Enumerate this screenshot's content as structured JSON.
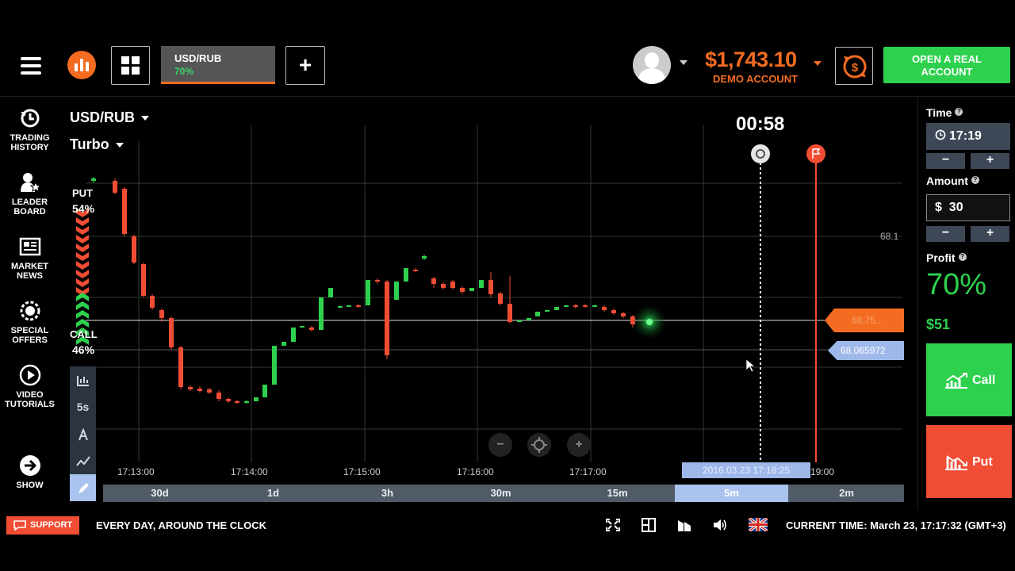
{
  "header": {
    "asset_tab": {
      "name": "USD/RUB",
      "payout": "70%"
    },
    "add_label": "+",
    "balance": "$1,743.10",
    "account_type": "DEMO ACCOUNT",
    "open_real_line1": "OPEN A REAL",
    "open_real_line2": "ACCOUNT",
    "accent_color": "#f36c21",
    "green_color": "#2ed14e"
  },
  "sidebar": {
    "items": [
      {
        "icon": "history-icon",
        "line1": "TRADING",
        "line2": "HISTORY"
      },
      {
        "icon": "leaderboard-icon",
        "line1": "LEADER",
        "line2": "BOARD"
      },
      {
        "icon": "newspaper-icon",
        "line1": "MARKET",
        "line2": "NEWS"
      },
      {
        "icon": "gear-icon",
        "line1": "SPECIAL",
        "line2": "OFFERS"
      },
      {
        "icon": "play-icon",
        "line1": "VIDEO",
        "line2": "TUTORIALS"
      },
      {
        "icon": "arrow-right-icon",
        "line1": "SHOW",
        "line2": ""
      }
    ]
  },
  "chart": {
    "pair": "USD/RUB",
    "mode": "Turbo",
    "countdown": "00:58",
    "put_label": "PUT",
    "put_pct": "54%",
    "call_label": "CALL",
    "call_pct": "46%",
    "tools": [
      "5s"
    ],
    "price_high": "68.1",
    "price_current": "68.75...",
    "price_line": "68.065972",
    "time_ticks": [
      "17:13:00",
      "17:14:00",
      "17:15:00",
      "17:16:00",
      "17:17:00",
      "19:00"
    ],
    "expiry_label": "2016.03.23 17:18:25",
    "zoom_out": "−",
    "zoom_in": "+"
  },
  "timeframes": {
    "items": [
      "30d",
      "1d",
      "3h",
      "30m",
      "15m",
      "5m",
      "2m"
    ],
    "active": "5m"
  },
  "right_panel": {
    "time_label": "Time",
    "time_value": "17:19",
    "amount_label": "Amount",
    "amount_value": "$  30",
    "minus": "−",
    "plus": "+",
    "profit_label": "Profit",
    "profit_pct": "70%",
    "profit_amount": "$51",
    "call_label": "Call",
    "put_label": "Put",
    "call_color": "#2ed14e",
    "put_color": "#f14d34"
  },
  "footer": {
    "support": "SUPPORT",
    "tagline": "EVERY DAY, AROUND THE CLOCK",
    "current_time": "CURRENT TIME: March 23, 17:17:32 (GMT+3)"
  }
}
